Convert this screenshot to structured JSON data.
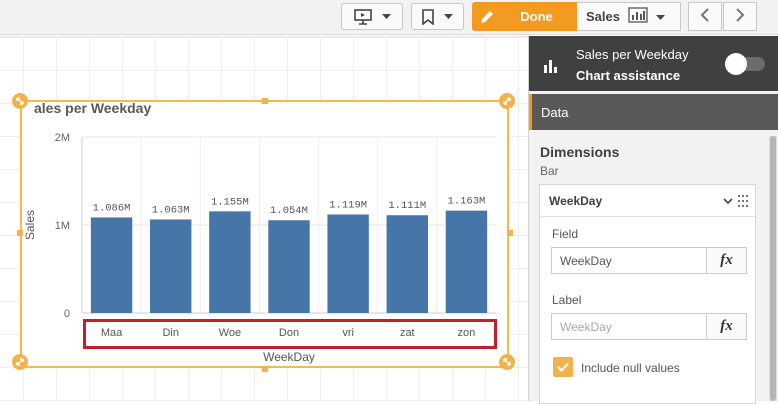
{
  "toolbar": {
    "present_icon": "presentation-icon",
    "bookmark_icon": "bookmark-icon",
    "done_label": "Done",
    "sales_label": "Sales",
    "sheet_icon": "sheet-chart-icon",
    "prev_icon": "chevron-left-icon",
    "next_icon": "chevron-right-icon",
    "accent": "#f39a21"
  },
  "chart": {
    "title": "ales per Weekday",
    "selection_color": "#f5b94c"
  },
  "chart_data": {
    "type": "bar",
    "categories": [
      "Maa",
      "Din",
      "Woe",
      "Don",
      "vri",
      "zat",
      "zon"
    ],
    "values": [
      1086000,
      1063000,
      1155000,
      1054000,
      1119000,
      1111000,
      1163000
    ],
    "data_labels": [
      "1.086M",
      "1.063M",
      "1.155M",
      "1.054M",
      "1.119M",
      "1.111M",
      "1.163M"
    ],
    "title": "ales per Weekday",
    "xlabel": "WeekDay",
    "ylabel": "Sales",
    "y_ticks": [
      0,
      1000000,
      2000000
    ],
    "y_tick_labels": [
      "0",
      "1M",
      "2M"
    ],
    "ylim": [
      0,
      2000000
    ],
    "bar_color": "#4676a8",
    "grid": true
  },
  "panel": {
    "header_title": "Sales per Weekday",
    "header_subtitle": "Chart assistance",
    "header_icon": "bar-chart-icon",
    "data_tab": "Data",
    "dimensions_title": "Dimensions",
    "dimensions_subtitle": "Bar",
    "dimension": {
      "name": "WeekDay",
      "field_label": "Field",
      "field_value": "WeekDay",
      "label_label": "Label",
      "label_placeholder": "WeekDay",
      "fx": "fx",
      "include_null_label": "Include null values",
      "include_null_checked": true
    }
  }
}
